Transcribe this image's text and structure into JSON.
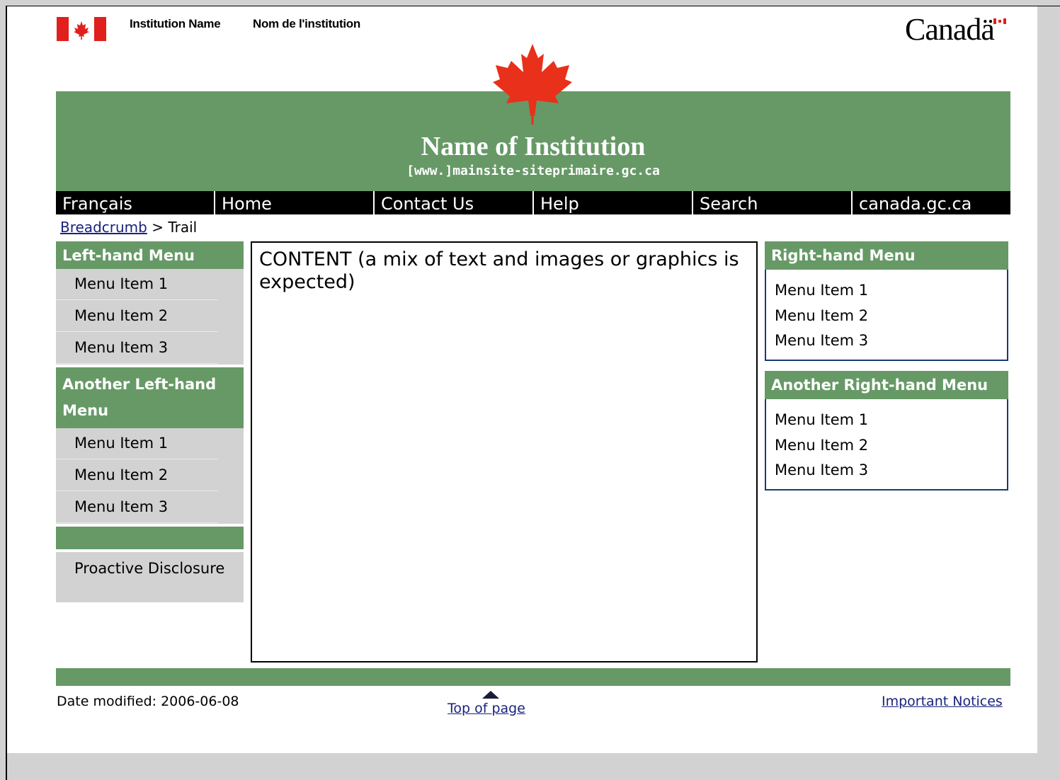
{
  "header": {
    "institution_name_en": "Institution Name",
    "institution_name_fr": "Nom de l'institution",
    "wordmark": "Canadä",
    "site_name": "Name of Institution",
    "site_url": "[www.]mainsite-siteprimaire.gc.ca",
    "banner_color": "#669966"
  },
  "nav": {
    "items": [
      "Français",
      "Home",
      "Contact Us",
      "Help",
      "Search",
      "canada.gc.ca"
    ]
  },
  "breadcrumb": {
    "link": "Breadcrumb",
    "separator": ">",
    "current": "Trail"
  },
  "left_menus": [
    {
      "title": "Left-hand Menu",
      "items": [
        "Menu Item 1",
        "Menu Item 2",
        "Menu Item 3"
      ]
    },
    {
      "title": "Another Left-hand Menu",
      "items": [
        "Menu Item 1",
        "Menu Item 2",
        "Menu Item 3"
      ]
    }
  ],
  "proactive_disclosure": "Proactive Disclosure",
  "content": {
    "text": "CONTENT (a mix of text and images or graphics is expected)"
  },
  "right_menus": [
    {
      "title": "Right-hand Menu",
      "items": [
        "Menu Item 1",
        "Menu Item 2",
        "Menu Item 3"
      ]
    },
    {
      "title": "Another Right-hand Menu",
      "items": [
        "Menu Item 1",
        "Menu Item 2",
        "Menu Item 3"
      ]
    }
  ],
  "footer": {
    "date_modified": "Date modified: 2006-06-08",
    "top_of_page": "Top of page",
    "important_notices": "Important Notices"
  },
  "icons": {
    "flag": "canada-flag-icon",
    "leaf": "maple-leaf-icon",
    "top_arrow": "up-arrow-icon"
  }
}
